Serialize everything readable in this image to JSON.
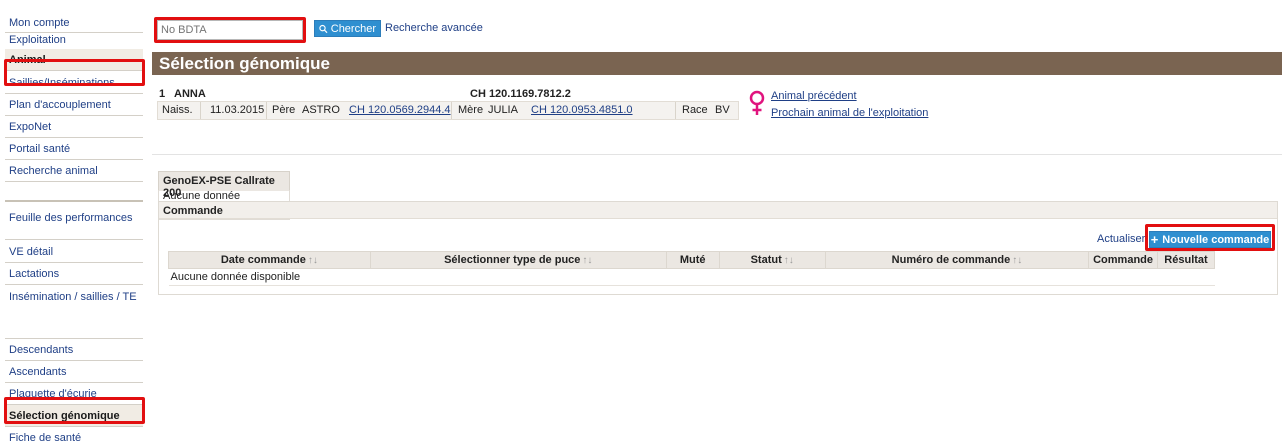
{
  "search": {
    "placeholder": "No BDTA",
    "button_label": "Chercher",
    "advanced_link": "Recherche avancée"
  },
  "sidebar": {
    "items": [
      {
        "label": "Mon compte"
      },
      {
        "label": "Exploitation"
      },
      {
        "label": "Animal",
        "active": true
      },
      {
        "label": "Saillies/Inséminations"
      },
      {
        "label": "Plan d'accouplement"
      },
      {
        "label": "ExpoNet"
      },
      {
        "label": "Portail santé"
      },
      {
        "label": "Recherche animal"
      },
      {
        "label": "Feuille des performances"
      },
      {
        "label": "VE détail"
      },
      {
        "label": "Lactations"
      },
      {
        "label": "Insémination / saillies / TE"
      },
      {
        "label": "Descendants"
      },
      {
        "label": "Ascendants"
      },
      {
        "label": "Plaquette d'écurie"
      },
      {
        "label": "Sélection génomique",
        "active": true
      },
      {
        "label": "Fiche de santé"
      }
    ]
  },
  "page": {
    "title": "Sélection génomique"
  },
  "animal": {
    "number": "1",
    "name": "ANNA",
    "id": "CH 120.1169.7812.2",
    "birth_label": "Naiss.",
    "birth_date": "11.03.2015",
    "father_label": "Père",
    "father_name": "ASTRO",
    "father_id": "CH 120.0569.2944.4",
    "mother_label": "Mère",
    "mother_name": "JULIA",
    "mother_id": "CH 120.0953.4851.0",
    "breed_label": "Race",
    "breed": "BV",
    "sex_icon": "female-icon",
    "sex_color": "#e0147e",
    "prev_link": "Animal précédent",
    "next_link": "Prochain animal de l'exploitation"
  },
  "genoex": {
    "title": "GenoEX-PSE Callrate 200",
    "empty": "Aucune donnée disponible"
  },
  "commande": {
    "title": "Commande",
    "refresh_label": "Actualiser",
    "new_order_label": "Nouvelle commande",
    "columns": [
      "Date commande",
      "Sélectionner type de puce",
      "Muté",
      "Statut",
      "Numéro de commande",
      "Commande",
      "Résultat"
    ],
    "sortable": [
      true,
      true,
      false,
      true,
      true,
      false,
      false
    ],
    "empty": "Aucune donnée disponible"
  },
  "colors": {
    "title_bar": "#7a6451",
    "highlight": "#e20f10",
    "button": "#2f8fd0",
    "link": "#1f3f86"
  }
}
